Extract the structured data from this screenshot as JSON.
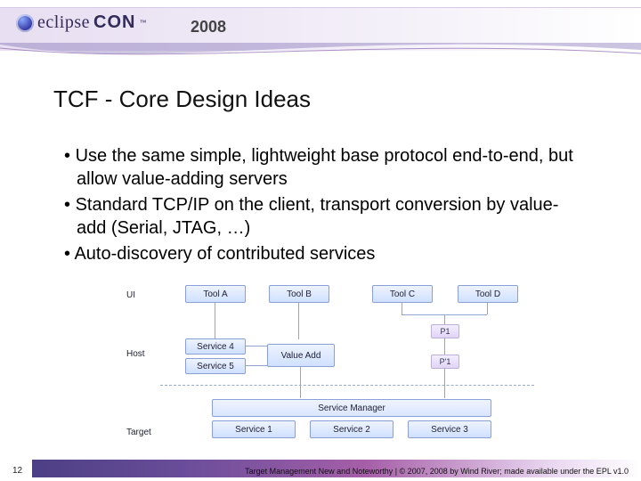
{
  "header": {
    "brand_prefix": "eclipse",
    "brand_suffix": "CON",
    "tm": "™",
    "year": "2008"
  },
  "title": "TCF - Core Design Ideas",
  "bullets": [
    "Use the same simple, lightweight base protocol end-to-end, but allow value-adding servers",
    "Standard TCP/IP on the client, transport conversion by value-add (Serial, JTAG, …)",
    "Auto-discovery of contributed services"
  ],
  "diagram": {
    "layers": {
      "ui": "UI",
      "host": "Host",
      "target": "Target"
    },
    "tools": [
      "Tool A",
      "Tool B",
      "Tool C",
      "Tool D"
    ],
    "host_side": [
      "Service 4",
      "Service 5"
    ],
    "value_add": "Value Add",
    "p": {
      "p1": "P1",
      "pp1": "P'1"
    },
    "service_mgr": "Service Manager",
    "services": [
      "Service 1",
      "Service 2",
      "Service 3"
    ]
  },
  "footer": {
    "page": "12",
    "text": "Target Management New and Noteworthy | © 2007, 2008 by Wind River; made available under the EPL v1.0"
  }
}
